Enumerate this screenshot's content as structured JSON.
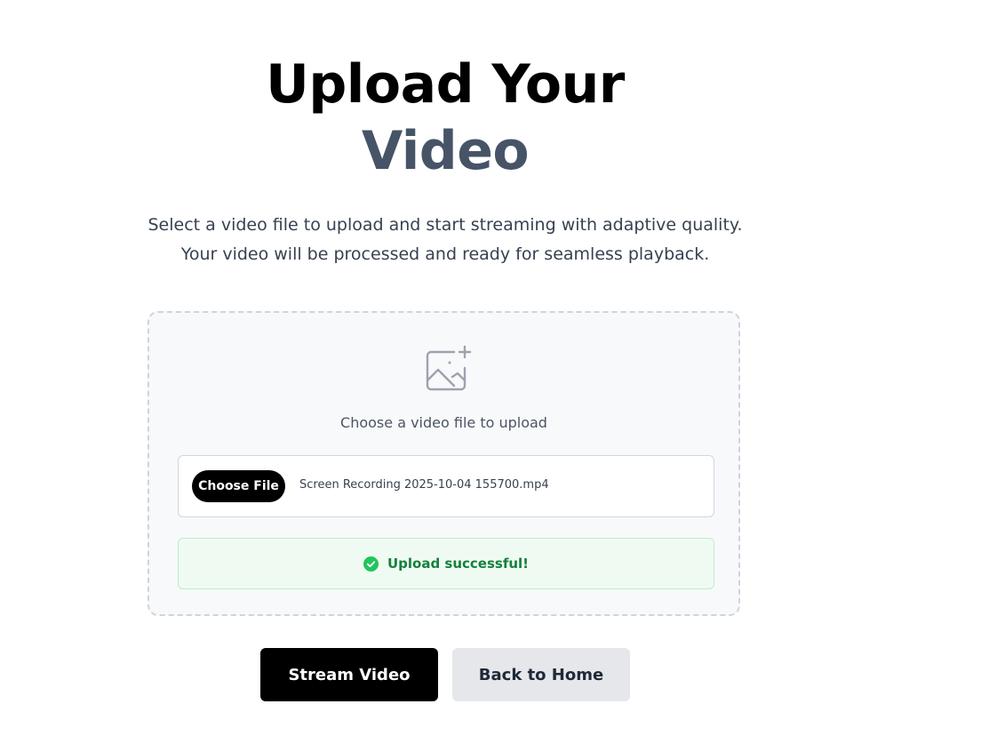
{
  "heading": {
    "line1": "Upload Your",
    "line2": "Video"
  },
  "subtitle": "Select a video file to upload and start streaming with adaptive quality. Your video will be processed and ready for seamless playback.",
  "dropzone": {
    "icon": "image-plus-icon",
    "prompt": "Choose a video file to upload",
    "choose_button": "Choose File",
    "file_name": "Screen Recording 2025-10-04 155700.mp4"
  },
  "status": {
    "icon": "check-circle-icon",
    "message": "Upload successful!",
    "color": "#22c55e"
  },
  "actions": {
    "stream_label": "Stream Video",
    "home_label": "Back to Home"
  }
}
